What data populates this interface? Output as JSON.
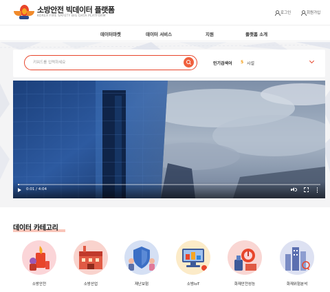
{
  "header": {
    "logo_title": "소방안전 빅데이터 플랫폼",
    "logo_subtitle": "KOREA FIRE SAFETY BIG DATA PLATFORM",
    "login_label": "로그인",
    "signup_label": "회원가입"
  },
  "nav": {
    "items": [
      {
        "label": "데이터마켓"
      },
      {
        "label": "데이터 서비스"
      },
      {
        "label": "지원"
      },
      {
        "label": "플랫폼 소개"
      }
    ]
  },
  "search": {
    "placeholder": "키워드를 입력하세요",
    "popular_label": "인기검색어",
    "popular_rank": "5",
    "popular_term": "시설"
  },
  "video": {
    "time": "0:01 / 4:04",
    "progress": 0.004
  },
  "categories": {
    "title": "데이터 카테고리",
    "items": [
      {
        "label": "소방안전",
        "icon": "fire-safety-icon"
      },
      {
        "label": "소방산업",
        "icon": "fire-industry-icon"
      },
      {
        "label": "재난보험",
        "icon": "disaster-insurance-icon"
      },
      {
        "label": "소방IoT",
        "icon": "fire-iot-icon"
      },
      {
        "label": "화재안전성능",
        "icon": "fire-safety-performance-icon"
      },
      {
        "label": "화재위험분석",
        "icon": "fire-risk-analysis-icon"
      }
    ]
  },
  "colors": {
    "accent": "#e8452b",
    "rank": "#f39c12",
    "highlight": "#f8b6a8"
  }
}
